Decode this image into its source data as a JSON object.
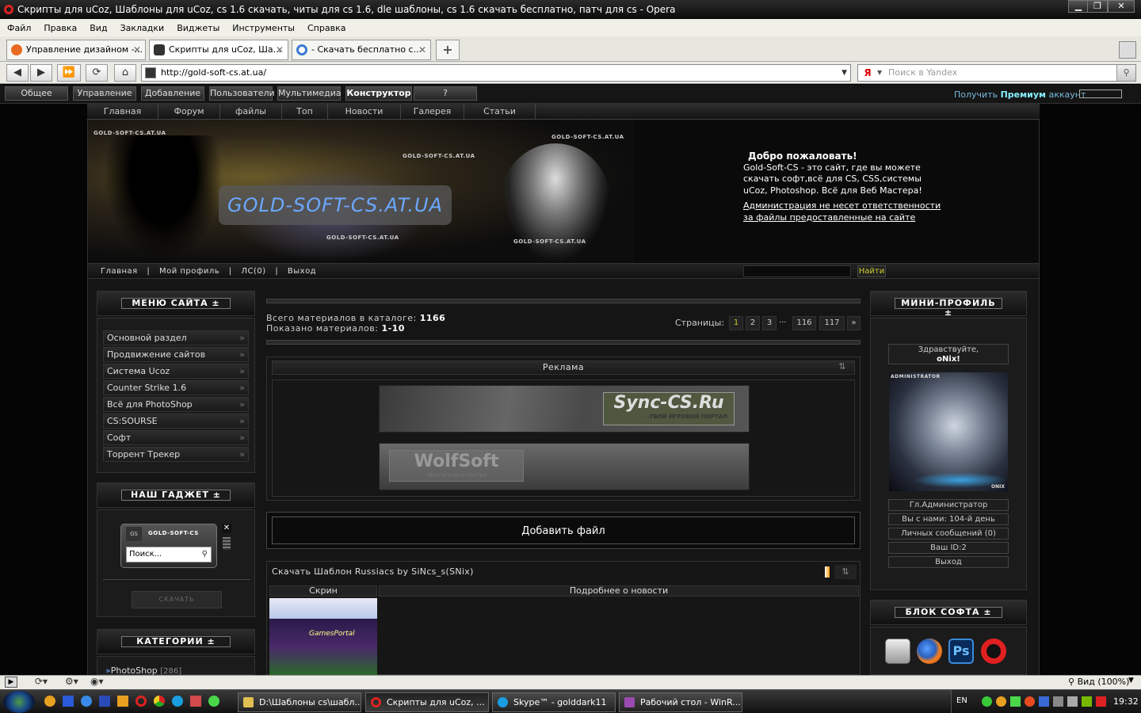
{
  "window": {
    "title": "Скрипты для uCoz, Шаблоны для uCoz, cs 1.6 скачать, читы для cs 1.6, dle шаблоны, cs 1.6 скачать бесплатно, патч для cs - Opera",
    "controls": {
      "minimize": "▁",
      "restore": "❐",
      "close": "✕"
    }
  },
  "menu": [
    "Файл",
    "Правка",
    "Вид",
    "Закладки",
    "Виджеты",
    "Инструменты",
    "Справка"
  ],
  "tabs": [
    {
      "label": "Управление дизайном -...",
      "close": "✕",
      "color": "#e86a20"
    },
    {
      "label": "Скрипты для uCoz, Ша...",
      "close": "✕",
      "color": "#333333"
    },
    {
      "label": "- Скачать бесплатно с...",
      "close": "✕",
      "color": "#3a7bd5"
    }
  ],
  "new_tab": "+",
  "address": {
    "url": "http://gold-soft-cs.at.ua/",
    "dropdown": "▼"
  },
  "search_box": {
    "placeholder": "Поиск в Yandex",
    "engine": "Я"
  },
  "ucoz_bar": {
    "buttons": [
      "Общее",
      "Управление",
      "Добавление",
      "Пользователи",
      "Мультимедиа",
      "Конструктор",
      "?"
    ],
    "premium_prefix": "Получить ",
    "premium_bold": "Премиум",
    "premium_suffix": " аккаунт"
  },
  "site_nav": [
    "Главная",
    "Форум",
    "файлы",
    "Топ",
    "Новости",
    "Галерея",
    "Статьи"
  ],
  "banner": {
    "watermarks": [
      "GOLD-SOFT-CS.AT.UA",
      "GOLD-SOFT-CS.AT.UA",
      "GOLD-SOFT-CS.AT.UA",
      "GOLD-SOFT-CS.AT.UA",
      "GOLD-SOFT-CS.AT.UA"
    ],
    "logo": "GOLD-SOFT-CS.AT.UA"
  },
  "welcome": {
    "heading": "Добро пожаловать!",
    "lines": [
      "Gold-Soft-CS - это сайт, где вы можете",
      "скачать софт,всё для CS, CSS,системы",
      "uCoz, Photoshop. Всё для Веб Мастера!"
    ],
    "disclaimer": [
      "Администрация не несет ответственности ",
      "за файлы предоставленные на сайте"
    ]
  },
  "user_nav": {
    "items": [
      "Главная",
      "Мой профиль",
      "ЛС(0)",
      "Выход"
    ],
    "sep": "|",
    "find": "Найти"
  },
  "left": {
    "menu_title": "МЕНЮ САЙТА ±",
    "menu_items": [
      "Основной раздел",
      "Продвижение сайтов",
      "Система Ucoz",
      "Counter Strike 1.6",
      "Всё для PhotoShop",
      "CS:SOURSE",
      "Софт",
      "Торрент Трекер"
    ],
    "arrow": "»",
    "gadget_title": "НАШ ГАДЖЕТ ±",
    "gadget": {
      "logo_letters": "GS",
      "name": "GOLD-SOFT-CS",
      "placeholder": "Поиск...",
      "close": "✕",
      "download": "СКАЧАТЬ"
    },
    "categories_title": "КАТЕГОРИИ ±",
    "categories": [
      {
        "bullet": "»",
        "name": "PhotoShop",
        "count": "[286]"
      }
    ]
  },
  "center": {
    "total_label": "Всего материалов в каталоге: ",
    "total": "1166",
    "shown_label": "Показано материалов: ",
    "shown": "1-10",
    "pages_label": "Страницы:",
    "pages": [
      "1",
      "2",
      "3",
      "...",
      "116",
      "117",
      "»"
    ],
    "ad_title": "Реклама",
    "ad_sort": "⇅",
    "ad_banners": [
      {
        "text": "Sync-CS.Ru",
        "sub": "-ТВОЙ ИГРОВОЙ ПОРТАЛ"
      },
      {
        "text": "WolfSoft",
        "sub": "ТВОЙ ИГРОВОЙ ПОРТАЛ"
      }
    ],
    "add_file": "Добавить файл",
    "news_title": "Скачать Шаблон Russiacs by SiNcs_s(SNix)",
    "news_sort": "⇅",
    "col_screen": "Скрин",
    "col_details": "Подробнее о новости",
    "thumb_text": "GamesPortal"
  },
  "right": {
    "profile_title": "МИНИ-ПРОФИЛЬ ±",
    "greeting": "Здравствуйте,",
    "username": "oNix!",
    "avatar_top": "ADMINISTRATOR",
    "avatar_bottom": "ONIX",
    "info": [
      "Гл.Администратор",
      "Вы с нами: 104-й день",
      "Личных сообщений (0)",
      "Ваш ID:2",
      "Выход"
    ],
    "soft_title": "БЛОК СОФТА ±",
    "soft_icons": [
      "Ps"
    ]
  },
  "statusbar": {
    "zoom": "Вид (100%)"
  },
  "taskbar": {
    "tasks": [
      {
        "label": "D:\\Шаблоны cs\\шабл...",
        "color": "#e0c050"
      },
      {
        "label": "Скрипты для uCoz, ...",
        "color": "#d22222"
      },
      {
        "label": "Skype™ - golddark11",
        "color": "#1a9ee0"
      },
      {
        "label": "Рабочий стол - WinR...",
        "color": "#9a4ab0"
      }
    ],
    "lang": "EN",
    "clock": "19:32"
  }
}
